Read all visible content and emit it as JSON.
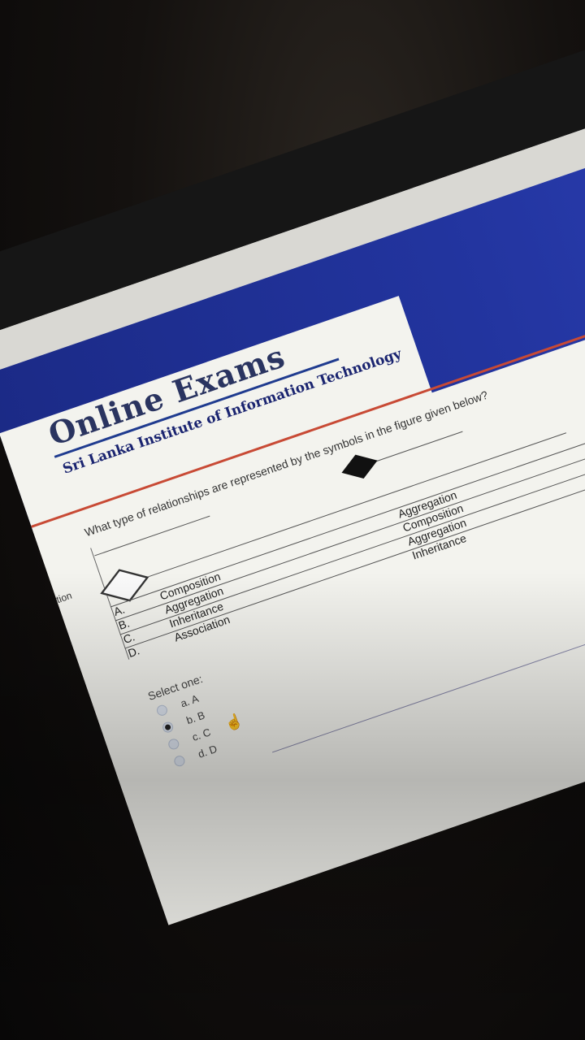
{
  "header": {
    "title": "Online Exams",
    "subtitle": "Sri Lanka Institute of Information Technology",
    "brand_color": "#22349e"
  },
  "sidebar": {
    "partial_label": "tion"
  },
  "question": {
    "text": "What type of relationships are represented by the symbols in the figure given below?",
    "figure": {
      "left_symbol": "hollow-diamond-icon",
      "right_symbol": "filled-diamond-icon"
    },
    "rows": [
      {
        "letter": "A.",
        "left": "Composition",
        "right": "Aggregation"
      },
      {
        "letter": "B.",
        "left": "Aggregation",
        "right": "Composition"
      },
      {
        "letter": "C.",
        "left": "Inheritance",
        "right": "Aggregation"
      },
      {
        "letter": "D.",
        "left": "Association",
        "right": "Inheritance"
      }
    ]
  },
  "answer": {
    "prompt": "Select one:",
    "options": [
      {
        "label": "a. A",
        "checked": false
      },
      {
        "label": "b. B",
        "checked": true
      },
      {
        "label": "c. C",
        "checked": false
      },
      {
        "label": "d. D",
        "checked": false
      }
    ]
  }
}
